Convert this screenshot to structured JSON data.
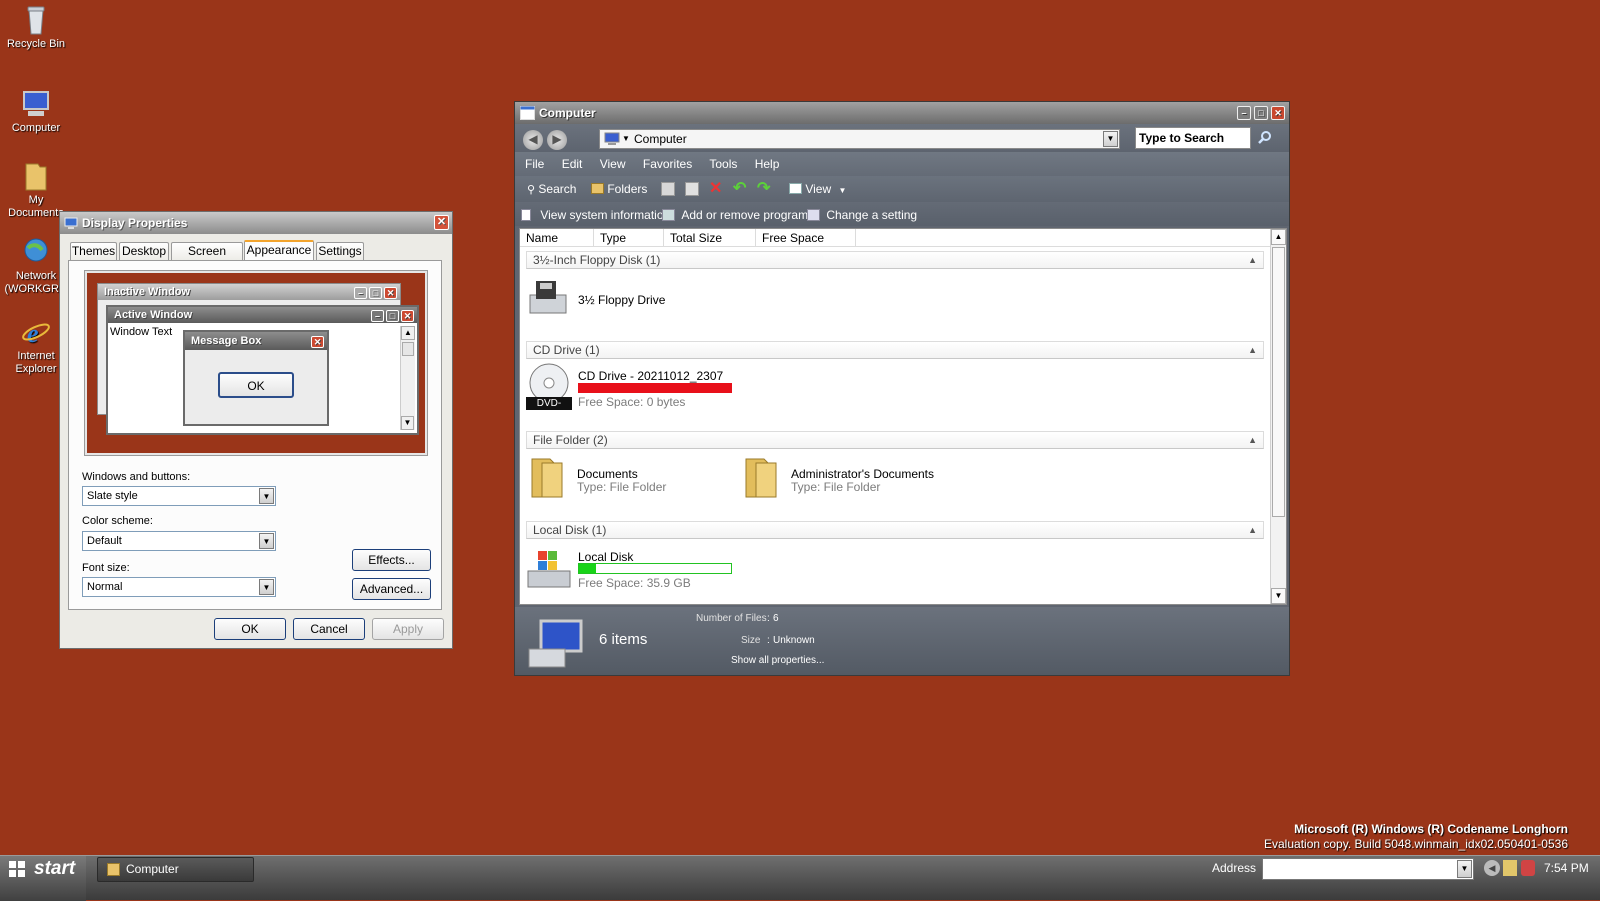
{
  "desktop": {
    "icons": [
      {
        "label": "Recycle Bin",
        "icon": "recycle-bin-icon"
      },
      {
        "label": "Computer",
        "icon": "computer-icon"
      },
      {
        "label": "My Documents",
        "icon": "folder-icon"
      },
      {
        "label": "Network",
        "label2": "(WORKGRO",
        "icon": "network-icon"
      },
      {
        "label": "Internet",
        "label2": "Explorer",
        "icon": "internet-explorer-icon"
      }
    ],
    "watermark_line1": "Microsoft (R) Windows (R) Codename Longhorn",
    "watermark_line2": "Evaluation copy. Build 5048.winmain_idx02.050401-0536",
    "background_color": "#9a3519"
  },
  "display_properties": {
    "title": "Display Properties",
    "tabs": [
      "Themes",
      "Desktop",
      "Screen Saver",
      "Appearance",
      "Settings"
    ],
    "active_tab": "Appearance",
    "preview": {
      "inactive_title": "Inactive Window",
      "active_title": "Active Window",
      "window_text": "Window Text",
      "msgbox_title": "Message Box",
      "msgbox_ok": "OK"
    },
    "windows_buttons_label": "Windows and buttons:",
    "windows_buttons_value": "Slate style",
    "color_scheme_label": "Color scheme:",
    "color_scheme_value": "Default",
    "font_size_label": "Font size:",
    "font_size_value": "Normal",
    "effects_button": "Effects...",
    "advanced_button": "Advanced...",
    "ok_button": "OK",
    "cancel_button": "Cancel",
    "apply_button": "Apply"
  },
  "explorer": {
    "title": "Computer",
    "address": "Computer",
    "search_placeholder": "Type to Search",
    "menu": [
      "File",
      "Edit",
      "View",
      "Favorites",
      "Tools",
      "Help"
    ],
    "toolbar": {
      "search": "Search",
      "folders": "Folders",
      "view": "View"
    },
    "tasks": [
      "View system information",
      "Add or remove programs",
      "Change a setting"
    ],
    "columns": [
      "Name",
      "Type",
      "Total Size",
      "Free Space"
    ],
    "groups": [
      {
        "header": "3½-Inch Floppy Disk (1)",
        "items": [
          {
            "name": "3½ Floppy Drive"
          }
        ]
      },
      {
        "header": "CD Drive (1)",
        "items": [
          {
            "name": "CD Drive - 20211012_2307",
            "sub": "Free Space: 0 bytes",
            "badge": "DVD-ROM",
            "fill": 1.0
          }
        ]
      },
      {
        "header": "File Folder (2)",
        "items": [
          {
            "name": "Documents",
            "sub": "Type: File Folder"
          },
          {
            "name": "Administrator's Documents",
            "sub": "Type: File Folder"
          }
        ]
      },
      {
        "header": "Local Disk (1)",
        "items": [
          {
            "name": "Local Disk",
            "sub": "Free Space: 35.9 GB",
            "fill": 0.11
          }
        ]
      }
    ],
    "details": {
      "count": "6 items",
      "files_label": "Number of Files",
      "files_value": "6",
      "size_label": "Size",
      "size_value": "Unknown",
      "show_all": "Show all properties..."
    }
  },
  "taskbar": {
    "start": "start",
    "task_button": "Computer",
    "address_label": "Address",
    "time": "7:54 PM"
  }
}
